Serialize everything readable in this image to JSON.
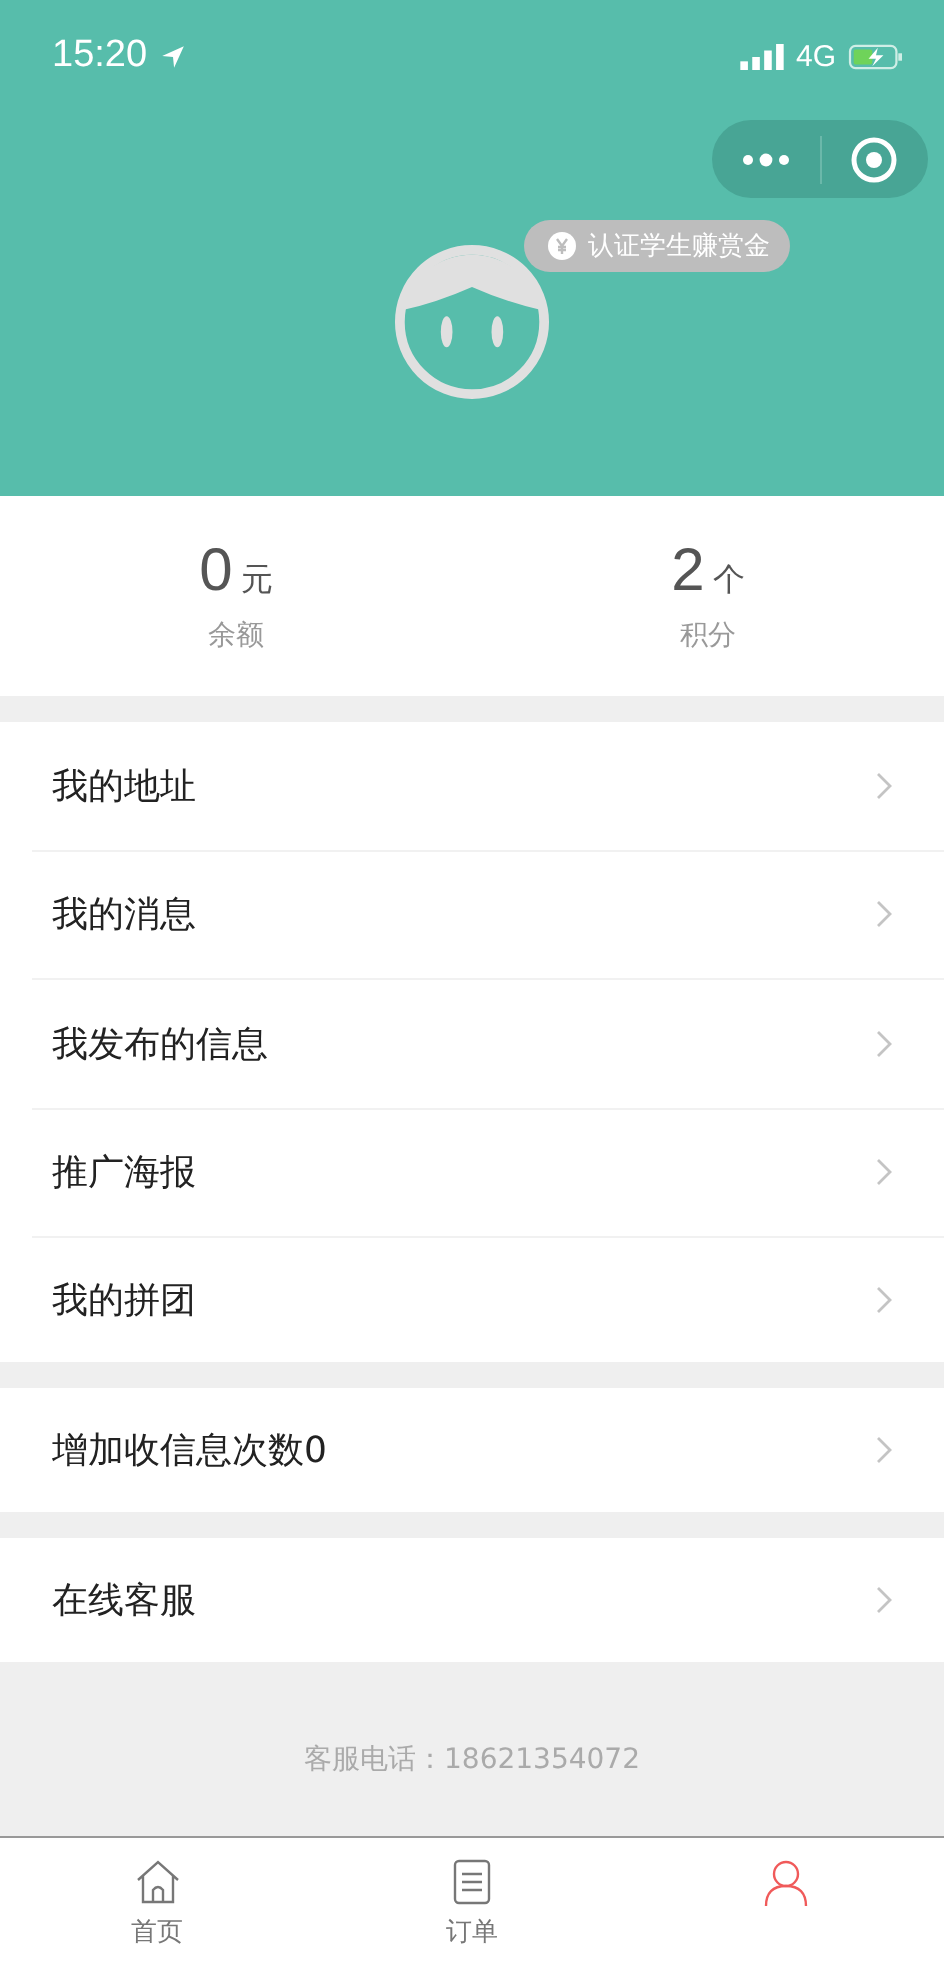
{
  "status_bar": {
    "time": "15:20",
    "network": "4G"
  },
  "badge": {
    "text": "认证学生赚赏金"
  },
  "stats": [
    {
      "value": "0",
      "unit": "元",
      "label": "余额"
    },
    {
      "value": "2",
      "unit": "个",
      "label": "积分"
    }
  ],
  "menu_groups": [
    {
      "items": [
        "我的地址",
        "我的消息",
        "我发布的信息",
        "推广海报",
        "我的拼团"
      ]
    },
    {
      "items": [
        "增加收信息次数0"
      ]
    },
    {
      "items": [
        "在线客服"
      ]
    }
  ],
  "footer": {
    "text": "客服电话：18621354072"
  },
  "tab_bar": [
    {
      "kind": "home",
      "label": "首页",
      "selected": false
    },
    {
      "kind": "orders",
      "label": "订单",
      "selected": false
    },
    {
      "kind": "profile",
      "selected": true
    }
  ]
}
